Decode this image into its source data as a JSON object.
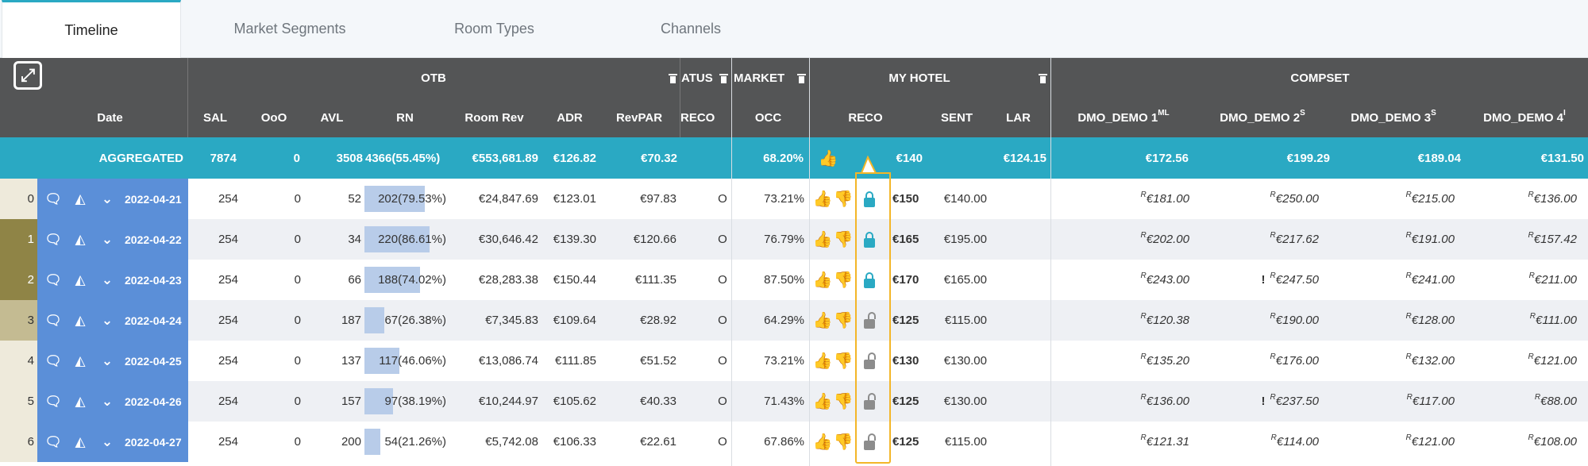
{
  "tabs": [
    {
      "label": "Timeline",
      "active": true
    },
    {
      "label": "Market Segments",
      "active": false
    },
    {
      "label": "Room Types",
      "active": false
    },
    {
      "label": "Channels",
      "active": false
    }
  ],
  "groups": {
    "otb": "OTB",
    "status": "ATUS",
    "market": "MARKET",
    "my_hotel": "MY HOTEL",
    "compset": "COMPSET"
  },
  "columns": {
    "date": "Date",
    "sal": "SAL",
    "ooo": "OoO",
    "avl": "AVL",
    "rn": "RN",
    "room_rev": "Room Rev",
    "adr": "ADR",
    "revpar": "RevPAR",
    "reco_status": "RECO",
    "occ": "OCC",
    "reco": "RECO",
    "sent": "SENT",
    "lar": "LAR",
    "comp1": "DMO_DEMO 1",
    "comp1_sup": "ML",
    "comp2": "DMO_DEMO 2",
    "comp2_sup": "S",
    "comp3": "DMO_DEMO 3",
    "comp3_sup": "S",
    "comp4": "DMO_DEMO 4",
    "comp4_sup": "I"
  },
  "aggregated": {
    "label": "AGGREGATED",
    "sal": "7874",
    "ooo": "0",
    "avl": "3508",
    "rn": "4366(55.45%)",
    "room_rev": "€553,681.89",
    "adr": "€126.82",
    "revpar": "€70.32",
    "occ": "68.20%",
    "reco": "€140",
    "lar": "€124.15",
    "comp1": "€172.56",
    "comp2": "€199.29",
    "comp3": "€189.04",
    "comp4": "€131.50"
  },
  "rows": [
    {
      "idx": "0",
      "date": "2022-04-21",
      "sal": "254",
      "ooo": "0",
      "avl": "52",
      "rn": "202(79.53%)",
      "rn_pct": 79.53,
      "room_rev": "€24,847.69",
      "adr": "€123.01",
      "revpar": "€97.83",
      "status": "O",
      "occ": "73.21%",
      "locked": true,
      "reco": "€150",
      "sent": "€140.00",
      "c1": "€181.00",
      "c2": "€250.00",
      "c2_warn": "",
      "c3": "€215.00",
      "c4": "€136.00",
      "idx_color": "#eeeadb"
    },
    {
      "idx": "1",
      "date": "2022-04-22",
      "sal": "254",
      "ooo": "0",
      "avl": "34",
      "rn": "220(86.61%)",
      "rn_pct": 86.61,
      "room_rev": "€30,646.42",
      "adr": "€139.30",
      "revpar": "€120.66",
      "status": "O",
      "occ": "76.79%",
      "locked": true,
      "reco": "€165",
      "sent": "€195.00",
      "c1": "€202.00",
      "c2": "€217.62",
      "c2_warn": "",
      "c3": "€191.00",
      "c4": "€157.42",
      "idx_color": "#8f8446"
    },
    {
      "idx": "2",
      "date": "2022-04-23",
      "sal": "254",
      "ooo": "0",
      "avl": "66",
      "rn": "188(74.02%)",
      "rn_pct": 74.02,
      "room_rev": "€28,283.38",
      "adr": "€150.44",
      "revpar": "€111.35",
      "status": "O",
      "occ": "87.50%",
      "locked": true,
      "reco": "€170",
      "sent": "€165.00",
      "c1": "€243.00",
      "c2": "€247.50",
      "c2_warn": "!",
      "c3": "€241.00",
      "c4": "€211.00",
      "idx_color": "#8f8446"
    },
    {
      "idx": "3",
      "date": "2022-04-24",
      "sal": "254",
      "ooo": "0",
      "avl": "187",
      "rn": "67(26.38%)",
      "rn_pct": 26.38,
      "room_rev": "€7,345.83",
      "adr": "€109.64",
      "revpar": "€28.92",
      "status": "O",
      "occ": "64.29%",
      "locked": false,
      "reco": "€125",
      "sent": "€115.00",
      "c1": "€120.38",
      "c2": "€190.00",
      "c2_warn": "",
      "c3": "€128.00",
      "c4": "€111.00",
      "idx_color": "#c4bb92"
    },
    {
      "idx": "4",
      "date": "2022-04-25",
      "sal": "254",
      "ooo": "0",
      "avl": "137",
      "rn": "117(46.06%)",
      "rn_pct": 46.06,
      "room_rev": "€13,086.74",
      "adr": "€111.85",
      "revpar": "€51.52",
      "status": "O",
      "occ": "73.21%",
      "locked": false,
      "reco": "€130",
      "sent": "€130.00",
      "c1": "€135.20",
      "c2": "€176.00",
      "c2_warn": "",
      "c3": "€132.00",
      "c4": "€121.00",
      "idx_color": "#eeeadb"
    },
    {
      "idx": "5",
      "date": "2022-04-26",
      "sal": "254",
      "ooo": "0",
      "avl": "157",
      "rn": "97(38.19%)",
      "rn_pct": 38.19,
      "room_rev": "€10,244.97",
      "adr": "€105.62",
      "revpar": "€40.33",
      "status": "O",
      "occ": "71.43%",
      "locked": false,
      "reco": "€125",
      "sent": "€130.00",
      "c1": "€136.00",
      "c2": "€237.50",
      "c2_warn": "!",
      "c3": "€117.00",
      "c4": "€88.00",
      "idx_color": "#eeeadb"
    },
    {
      "idx": "6",
      "date": "2022-04-27",
      "sal": "254",
      "ooo": "0",
      "avl": "200",
      "rn": "54(21.26%)",
      "rn_pct": 21.26,
      "room_rev": "€5,742.08",
      "adr": "€106.33",
      "revpar": "€22.61",
      "status": "O",
      "occ": "67.86%",
      "locked": false,
      "reco": "€125",
      "sent": "€115.00",
      "c1": "€121.31",
      "c2": "€114.00",
      "c2_warn": "",
      "c3": "€121.00",
      "c4": "€108.00",
      "idx_color": "#eeeadb"
    }
  ],
  "rate_prefix": "R",
  "icons": {
    "expand": "expand-icon",
    "comment": "comment-icon",
    "chart": "area-chart-icon",
    "chevron": "chevron-down-icon",
    "thumb_up": "thumbs-up-icon",
    "thumb_down": "thumbs-down-icon",
    "lock": "lock-icon",
    "trash": "trash-icon"
  },
  "colors": {
    "header": "#545556",
    "aggregated": "#2aa9c3",
    "date_cell": "#5b8fd8",
    "rn_bar": "#b8cce9",
    "highlight": "#f3b628"
  }
}
